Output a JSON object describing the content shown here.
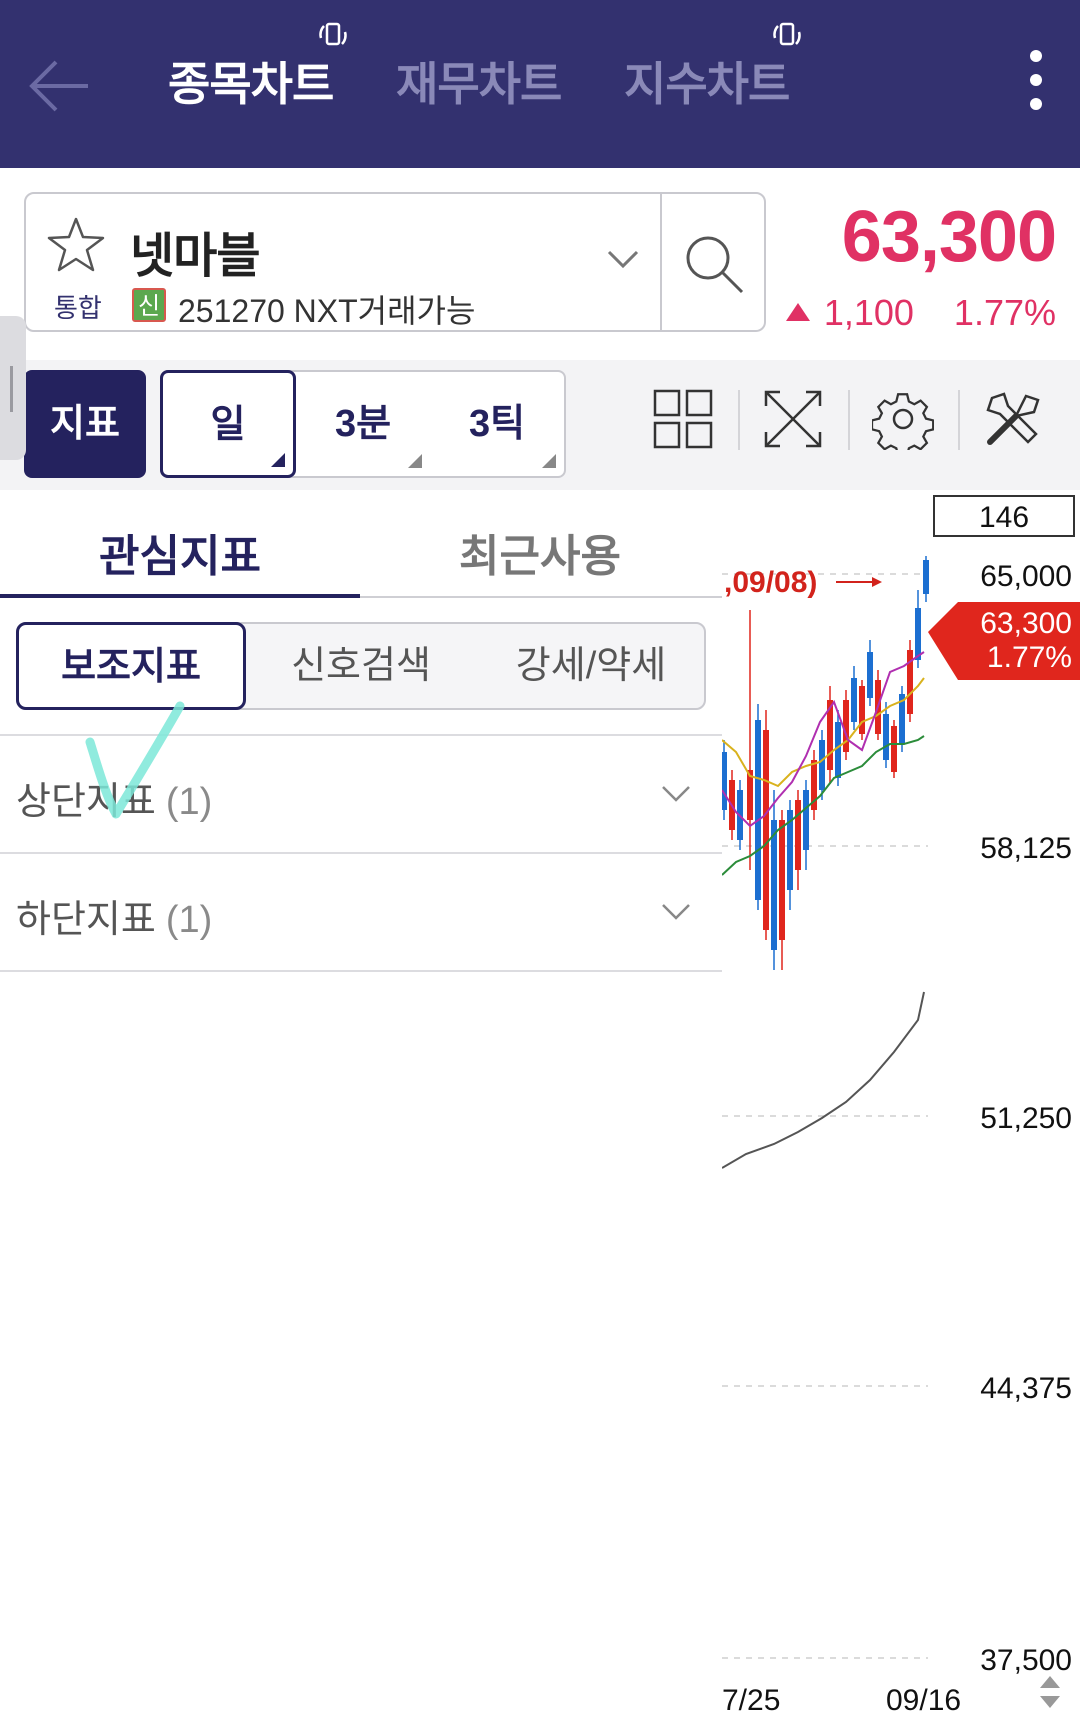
{
  "header": {
    "tabs": [
      {
        "label": "종목차트",
        "active": true
      },
      {
        "label": "재무차트",
        "active": false
      },
      {
        "label": "지수차트",
        "active": false
      }
    ],
    "icons": [
      "back-arrow-icon",
      "rotate-icon",
      "more-vertical-icon"
    ]
  },
  "stock": {
    "name": "넷마블",
    "market_label": "통합",
    "badge": "신",
    "code_line": "251270 NXT거래가능",
    "price": "63,300",
    "change": "1,100",
    "change_pct": "1.77%",
    "direction": "up",
    "color": "#e03164"
  },
  "toolbar": {
    "indicator_label": "지표",
    "periods": [
      "일",
      "3분",
      "3틱"
    ],
    "active_period": "일",
    "tools": [
      "grid-layout-icon",
      "fullscreen-icon",
      "settings-gear-icon",
      "tools-icon"
    ]
  },
  "panel": {
    "tabs": [
      {
        "label": "관심지표",
        "active": true
      },
      {
        "label": "최근사용",
        "active": false
      }
    ],
    "segments": [
      {
        "label": "보조지표",
        "active": true
      },
      {
        "label": "신호검색",
        "active": false
      },
      {
        "label": "강세/약세",
        "active": false
      }
    ],
    "sections": [
      {
        "label": "상단지표",
        "count": "(1)"
      },
      {
        "label": "하단지표",
        "count": "(1)"
      }
    ]
  },
  "chart": {
    "top_box": "146",
    "high_annotation": ",09/08)",
    "y_labels": [
      "65,000",
      "58,125",
      "51,250",
      "44,375",
      "37,500"
    ],
    "price_tag": "63,300",
    "price_tag_pct": "1.77%",
    "x_labels": [
      "7/25",
      "09/16"
    ],
    "colors": {
      "up": "#e0261d",
      "down": "#1c6fd1",
      "accent": "#e0261d"
    }
  }
}
